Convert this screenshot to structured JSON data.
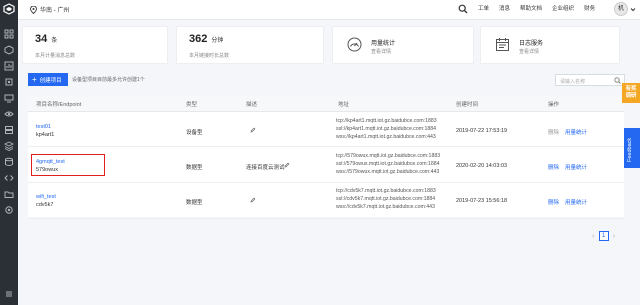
{
  "topbar": {
    "region": "华南 - 广州",
    "nav": [
      "工单",
      "消息",
      "帮助文档",
      "企业组织",
      "财务"
    ],
    "avatar_text": "机"
  },
  "stats": {
    "messages": {
      "value": "34",
      "unit": "条",
      "label": "本月计量消息总数"
    },
    "minutes": {
      "value": "362",
      "unit": "分钟",
      "label": "本月链接时长总数"
    },
    "usage": {
      "title": "用量统计",
      "link": "查看详情"
    },
    "logs": {
      "title": "日志服务",
      "link": "查看详情"
    }
  },
  "toolbar": {
    "create_label": "创建项目",
    "tip": "设备型项目目前最多允许创建1个",
    "search_placeholder": "请输入名称"
  },
  "table": {
    "headers": [
      "项目名称/Endpoint",
      "类型",
      "描述",
      "地址",
      "创建时间",
      "操作"
    ],
    "rows": [
      {
        "name": "test01",
        "endpoint": "kp4art1",
        "type": "设备型",
        "desc": "",
        "addr": [
          "tcp://kp4art1.mqtt.iot.gz.baidubce.com:1883",
          "ssl://kp4art1.mqtt.iot.gz.baidubce.com:1884",
          "wss://kp4art1.mqtt.iot.gz.baidubce.com:443"
        ],
        "created": "2019-07-22 17:53:19",
        "actions": [
          "删除",
          "用量统计"
        ]
      },
      {
        "name": "4gmqtt_test",
        "endpoint": "579owux",
        "type": "数据型",
        "desc": "连接百度云测试",
        "addr": [
          "tcp://579owux.mqtt.iot.gz.baidubce.com:1883",
          "ssl://579owux.mqtt.iot.gz.baidubce.com:1884",
          "wss://579owux.mqtt.iot.gz.baidubce.com:443"
        ],
        "created": "2020-02-20 14:03:03",
        "actions": [
          "删除",
          "用量统计"
        ]
      },
      {
        "name": "wifi_test",
        "endpoint": "cdv5k7",
        "type": "数据型",
        "desc": "",
        "addr": [
          "tcp://cdv5k7.mqtt.iot.gz.baidubce.com:1883",
          "ssl://cdv5k7.mqtt.iot.gz.baidubce.com:1884",
          "wss://cdv5k7.mqtt.iot.gz.baidubce.com:443"
        ],
        "created": "2019-07-23 15:56:18",
        "actions": [
          "删除",
          "用量统计"
        ]
      }
    ]
  },
  "pagination": {
    "current": "1"
  },
  "side": {
    "help_line1": "有奖",
    "help_line2": "调研",
    "feedback": "Feedback"
  },
  "colors": {
    "accent": "#2468f2",
    "rail": "#2b2f36",
    "highlight": "#e02020",
    "help": "#f5a623"
  }
}
